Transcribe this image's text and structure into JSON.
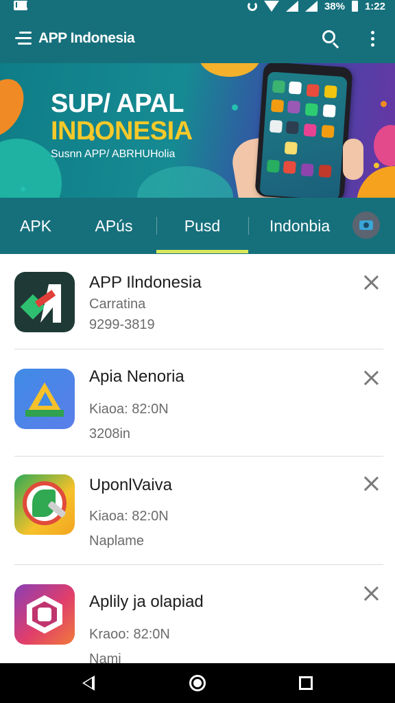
{
  "status_bar": {
    "battery_text": "38%",
    "time": "1:22"
  },
  "app_bar": {
    "title": "APP Indonesia"
  },
  "banner": {
    "headline_1": "SUP/ APAL",
    "headline_2": "INDONESIA",
    "subline": "Susnn APP/ ABRHUHolia"
  },
  "tabs": [
    {
      "label": "APK"
    },
    {
      "label": "APús"
    },
    {
      "label": "Pusd",
      "selected": true
    },
    {
      "label": "Indonbia"
    }
  ],
  "apps": [
    {
      "title": "APP Ilndonesia",
      "line1": "Carratina",
      "line2": "9299-3819",
      "icon": "app-indonesia-logo-icon"
    },
    {
      "title": "Apia Nenoria",
      "line1": "Kiaoa: 82:0N",
      "line2": "3208in",
      "icon": "drive-triangle-icon"
    },
    {
      "title": "UponlVaiva",
      "line1": "Kiaoa: 82:0N",
      "line2": "Naplame",
      "icon": "phone-leaf-icon"
    },
    {
      "title": "Aplily ja olapiad",
      "line1": "Kraoo: 82:0N",
      "line2": "Nami",
      "icon": "hexagon-camera-icon"
    }
  ],
  "colors": {
    "primary": "#16707c",
    "tab_indicator": "#d8e85a",
    "banner_yellow": "#f6c92a"
  }
}
